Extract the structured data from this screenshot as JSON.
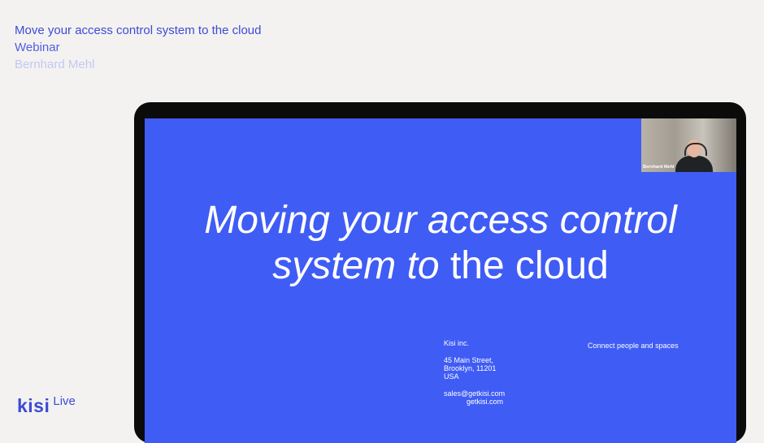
{
  "webinar": {
    "title": "Move your access control system to the cloud",
    "type": "Webinar",
    "presenter": "Bernhard Mehl"
  },
  "brand": {
    "logo": "kisi",
    "suffix": "Live"
  },
  "slide": {
    "title_line1_italic": "Moving your access control",
    "title_line2_italic": "system to",
    "title_line2_regular": " the cloud",
    "company": {
      "name": "Kisi inc.",
      "address1": "45 Main Street,",
      "address2": "Brooklyn, 11201",
      "country": "USA",
      "email": "sales@getkisi.com",
      "website": "getkisi.com"
    },
    "tagline": "Connect people and spaces"
  },
  "camera": {
    "name_tag": "Bernhard Mehl"
  },
  "colors": {
    "accent": "#3b4bd8",
    "slide_bg": "#3f5cf5",
    "page_bg": "#f4f2f0"
  }
}
